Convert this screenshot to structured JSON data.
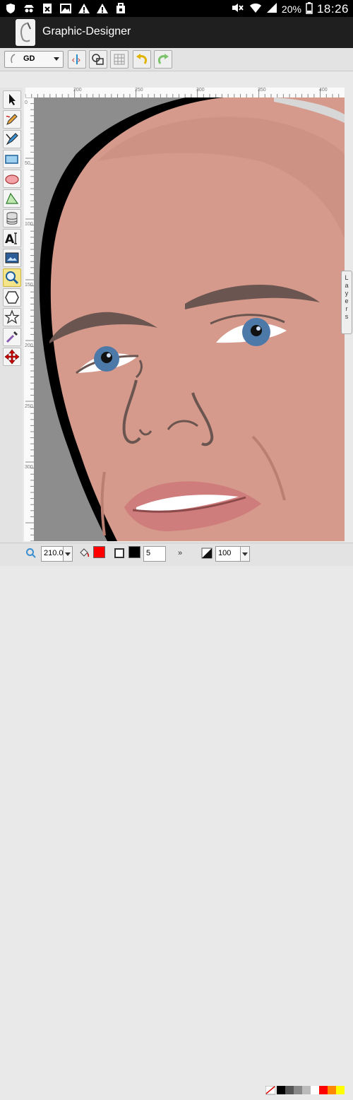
{
  "status_bar": {
    "battery": "20%",
    "time": "18:26"
  },
  "action_bar": {
    "title": "Graphic-Designer"
  },
  "toolbar": {
    "document_select": "GD"
  },
  "bottom_bar": {
    "zoom_value": "210.0",
    "stroke_width": "5",
    "more_label": "»",
    "opacity_value": "100"
  },
  "rulers": {
    "horizontal": [
      "200",
      "250",
      "300",
      "350",
      "400"
    ],
    "vertical": [
      "0",
      "50",
      "100",
      "150",
      "200",
      "250",
      "300"
    ]
  },
  "layers_tab": {
    "label": "Layers"
  },
  "colors": {
    "fill": "#ff0000",
    "stroke": "#000000",
    "skin": "#d59a8b",
    "background": "#8d8d8d",
    "active_tool": "#f4e58a"
  },
  "palette": [
    "#000000",
    "#555555",
    "#888888",
    "#bbbbbb",
    "#ffffff",
    "#ff0000",
    "#ff8800",
    "#ffff00"
  ],
  "icons": {
    "status_bar": [
      "shield-icon",
      "incognito-icon",
      "message-icon",
      "image-icon",
      "alert-icon",
      "alert-icon",
      "bag-icon",
      "mute-icon",
      "wifi-icon",
      "signal-icon",
      "battery-icon"
    ],
    "toolbar": [
      "document-icon",
      "code-icon",
      "shapes-icon",
      "grid-icon",
      "undo-icon",
      "redo-icon"
    ],
    "tools": [
      "pointer-icon",
      "pencil-icon",
      "pen-icon",
      "rectangle-icon",
      "ellipse-icon",
      "polygon-icon",
      "database-icon",
      "text-icon",
      "image-icon",
      "zoom-icon",
      "hexagon-icon",
      "star-icon",
      "eyedropper-icon",
      "move-icon"
    ]
  }
}
